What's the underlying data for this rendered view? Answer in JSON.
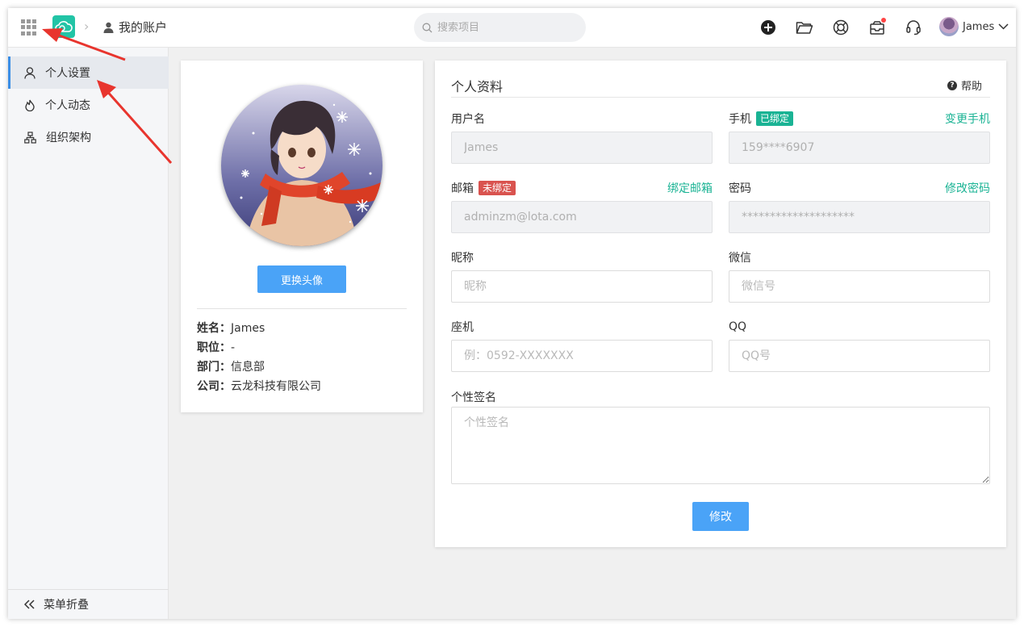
{
  "header": {
    "breadcrumb": "我的账户",
    "search_placeholder": "搜索项目",
    "user_name": "James"
  },
  "sidebar": {
    "items": [
      {
        "label": "个人设置",
        "icon": "user-icon"
      },
      {
        "label": "个人动态",
        "icon": "flame-icon"
      },
      {
        "label": "组织架构",
        "icon": "org-chart-icon"
      }
    ],
    "collapse_label": "菜单折叠"
  },
  "profile": {
    "change_avatar": "更换头像",
    "info": [
      {
        "key": "姓名：",
        "value": "James"
      },
      {
        "key": "职位：",
        "value": "-"
      },
      {
        "key": "部门：",
        "value": "信息部"
      },
      {
        "key": "公司：",
        "value": "云龙科技有限公司"
      }
    ]
  },
  "form": {
    "title": "个人资料",
    "help": "帮助",
    "username": {
      "label": "用户名",
      "value": "James"
    },
    "phone": {
      "label": "手机",
      "tag": "已绑定",
      "link": "变更手机",
      "value": "159****6907"
    },
    "email": {
      "label": "邮箱",
      "tag": "未绑定",
      "link": "绑定邮箱",
      "value": "adminzm@lota.com"
    },
    "password": {
      "label": "密码",
      "link": "修改密码",
      "value": "********************"
    },
    "nickname": {
      "label": "昵称",
      "placeholder": "昵称"
    },
    "wechat": {
      "label": "微信",
      "placeholder": "微信号"
    },
    "landline": {
      "label": "座机",
      "placeholder": "例：0592-XXXXXXX"
    },
    "qq": {
      "label": "QQ",
      "placeholder": "QQ号"
    },
    "signature": {
      "label": "个性签名",
      "placeholder": "个性签名"
    },
    "submit": "修改"
  },
  "colors": {
    "accent": "#4aa3f7",
    "green": "#1ab394",
    "red_tag": "#d9534f",
    "logo": "#22c4a6",
    "annotation": "#e8352e"
  }
}
